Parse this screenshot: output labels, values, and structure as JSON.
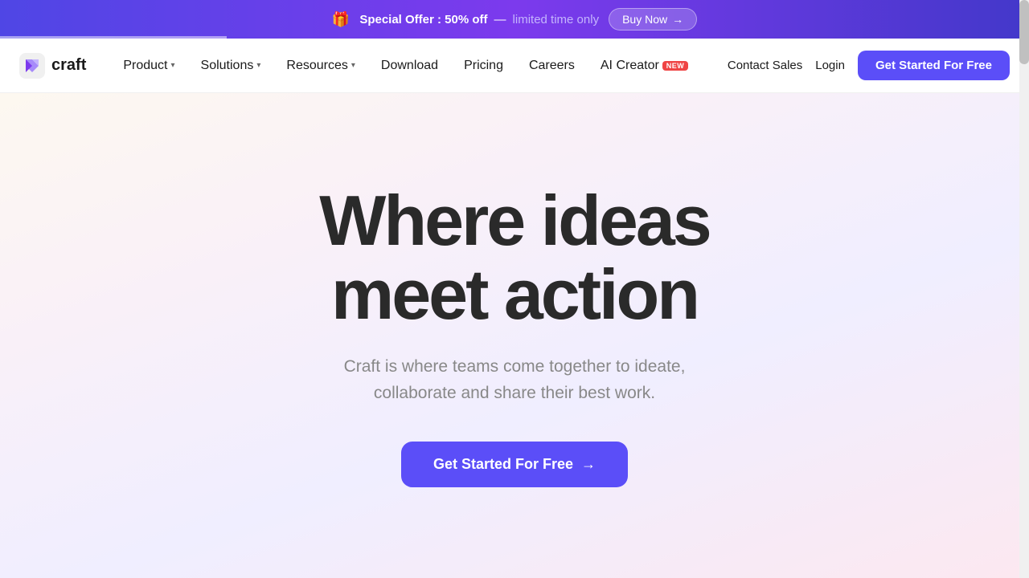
{
  "banner": {
    "gift_icon": "🎁",
    "offer_text": "Special Offer : 50% off",
    "separator": "—",
    "limited_text": "limited time only",
    "buy_label": "Buy Now",
    "buy_arrow": "→"
  },
  "navbar": {
    "logo_text": "craft",
    "nav_items": [
      {
        "label": "Product",
        "has_dropdown": true
      },
      {
        "label": "Solutions",
        "has_dropdown": true
      },
      {
        "label": "Resources",
        "has_dropdown": true
      },
      {
        "label": "Download",
        "has_dropdown": false
      },
      {
        "label": "Pricing",
        "has_dropdown": false
      },
      {
        "label": "Careers",
        "has_dropdown": false
      },
      {
        "label": "AI Creator",
        "has_dropdown": false,
        "badge": "NEW"
      }
    ],
    "contact_label": "Contact Sales",
    "login_label": "Login",
    "cta_label": "Get Started For Free"
  },
  "hero": {
    "title_line1": "Where ideas",
    "title_line2": "meet action",
    "subtitle": "Craft is where teams come together to ideate,\ncollaborate and share their best work.",
    "cta_label": "Get Started For Free",
    "cta_arrow": "→"
  }
}
